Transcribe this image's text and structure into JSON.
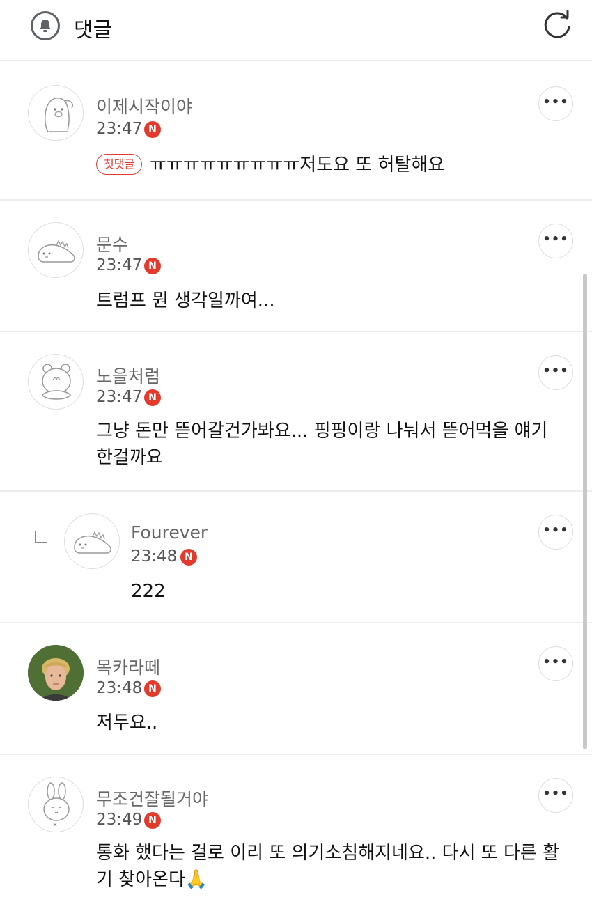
{
  "header": {
    "title": "댓글",
    "bell_icon": "bell-icon",
    "refresh_icon": "refresh-icon"
  },
  "badge_label": "N",
  "more_label": "•••",
  "comments": [
    {
      "nickname": "이제시작이야",
      "time": "23:47",
      "first_comment_badge": "첫댓글",
      "text": "ㅠㅠㅠㅠㅠㅠㅠㅠㅠ저도요 또 허탈해요",
      "avatar_icon": "penguin-pig-icon"
    },
    {
      "nickname": "문수",
      "time": "23:47",
      "text": "트럼프 뭔 생각일까여...",
      "avatar_icon": "dinosaur-icon"
    },
    {
      "nickname": "노을처럼",
      "time": "23:47",
      "text": "그냥 돈만 뜯어갈건가봐요... 핑핑이랑 나눠서 뜯어먹을 얘기한걸까요",
      "avatar_icon": "bear-icon"
    },
    {
      "nickname": "Fourever",
      "time": "23:48",
      "text": "222",
      "is_reply": true,
      "avatar_icon": "dinosaur-icon"
    },
    {
      "nickname": "목카라떼",
      "time": "23:48",
      "text": "저두요..",
      "avatar_icon": "photo-avatar"
    },
    {
      "nickname": "무조건잘될거야",
      "time": "23:49",
      "text": "통화 했다는 걸로 이리 또 의기소침해지네요.. 다시 또 다른 활기 찾아온다🙏",
      "avatar_icon": "rabbit-icon"
    }
  ]
}
